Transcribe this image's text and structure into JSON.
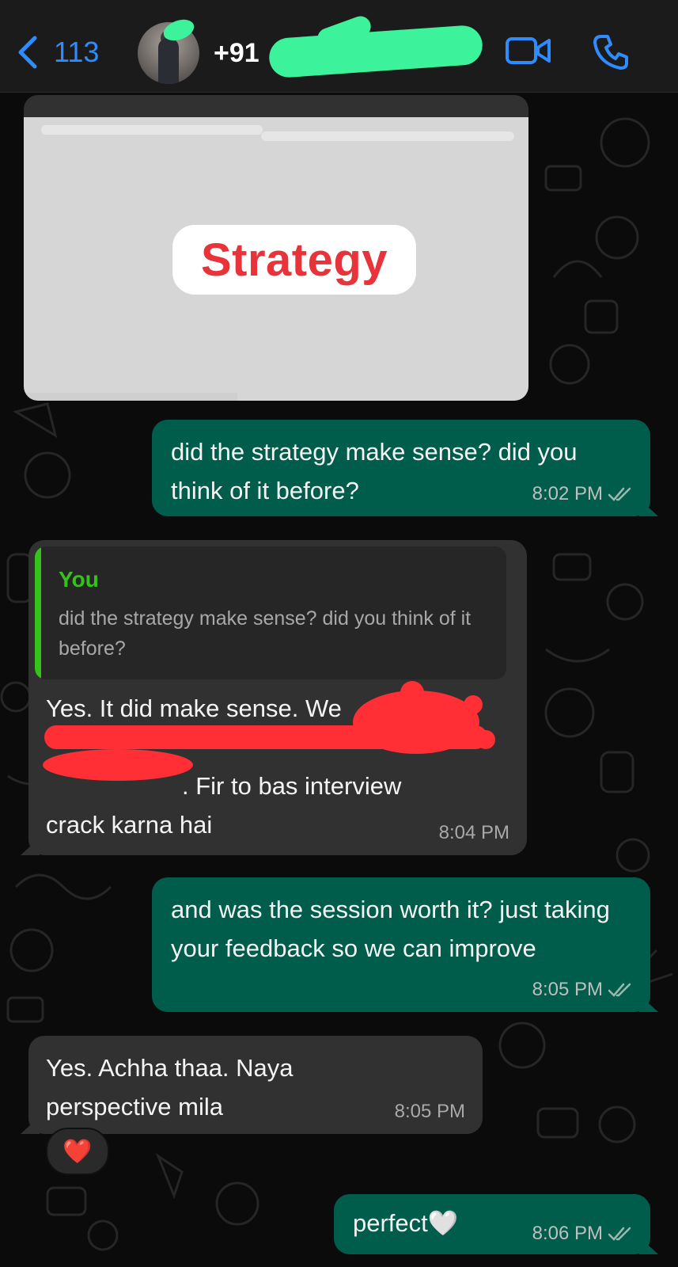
{
  "header": {
    "back_count": "113",
    "contact_name": "+91",
    "accent_color": "#2f8cff",
    "icons": [
      "chevron-left-icon",
      "video-call-icon",
      "phone-icon"
    ]
  },
  "image_message": {
    "overlay_label": "Strategy",
    "overlay_color": "#e8333a"
  },
  "messages": [
    {
      "direction": "outgoing",
      "text": "did the strategy make sense? did you think of it before?",
      "time": "8:02 PM",
      "read": true
    },
    {
      "direction": "incoming",
      "quote_author": "You",
      "quote_text": "did the strategy make sense? did you think of it before?",
      "text_lines": [
        "Yes. It did make sense. We ",
        "",
        ". Fir to bas interview",
        "crack karna hai"
      ],
      "time": "8:04 PM"
    },
    {
      "direction": "outgoing",
      "text": "and was the session worth it? just taking your feedback so we can improve",
      "time": "8:05 PM",
      "read": true
    },
    {
      "direction": "incoming",
      "text": "Yes. Achha thaa. Naya perspective mila",
      "time": "8:05 PM",
      "reaction": "❤️"
    },
    {
      "direction": "outgoing",
      "text": "perfect🤍",
      "time": "8:06 PM",
      "read": true
    }
  ],
  "colors": {
    "outgoing_bubble": "#005c4b",
    "incoming_bubble": "#313131",
    "reply_author": "#35c21b",
    "redaction": "#ff2f35",
    "name_redaction": "#3cf29b"
  }
}
